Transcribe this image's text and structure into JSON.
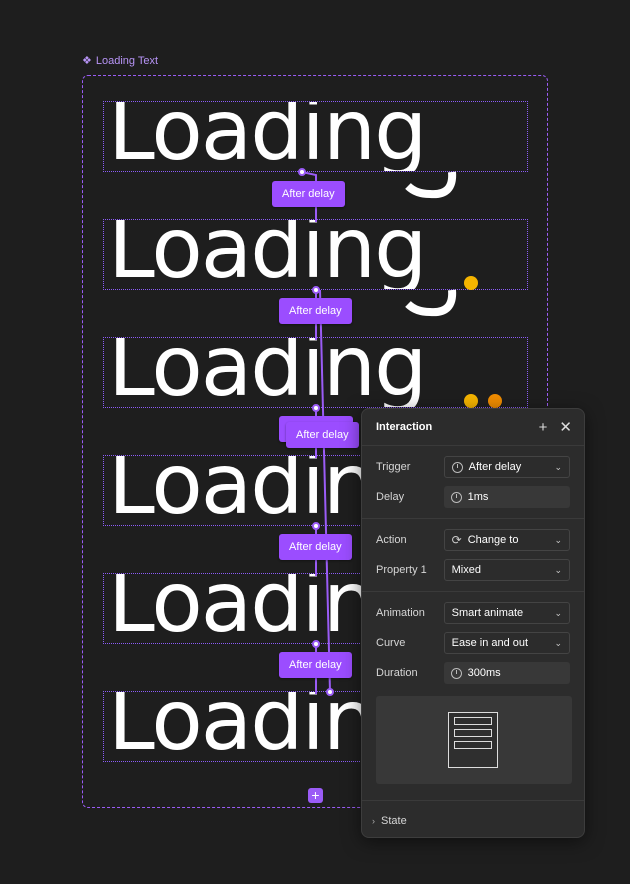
{
  "component": {
    "label": "Loading Text",
    "icon": "component-icon"
  },
  "variants": [
    {
      "word": "Loading",
      "dots": 0
    },
    {
      "word": "Loading",
      "dots": 1
    },
    {
      "word": "Loading",
      "dots": 2
    },
    {
      "word": "Loading",
      "dots": 3
    },
    {
      "word": "Loading",
      "dots": 3
    },
    {
      "word": "Loading",
      "dots": 3
    }
  ],
  "connections": [
    {
      "label": "After delay"
    },
    {
      "label": "After delay"
    },
    {
      "label": "After delay"
    },
    {
      "label": "After delay"
    },
    {
      "label": "After delay"
    }
  ],
  "colors": {
    "accent": "#9b5cf6",
    "tag": "#9b4dff",
    "dot_yellow": "#f5b400",
    "dot_orange": "#f08c00",
    "canvas": "#1e1e1e",
    "panel": "#2c2c2c"
  },
  "panel": {
    "title": "Interaction",
    "add_icon": "plus-icon",
    "close_icon": "close-icon",
    "trigger": {
      "label": "Trigger",
      "value": "After delay",
      "icon": "timer-icon"
    },
    "delay": {
      "label": "Delay",
      "value": "1ms",
      "icon": "timer-icon"
    },
    "action": {
      "label": "Action",
      "value": "Change to",
      "icon": "swap-icon"
    },
    "property": {
      "label": "Property 1",
      "value": "Mixed"
    },
    "animation": {
      "label": "Animation",
      "value": "Smart animate"
    },
    "curve": {
      "label": "Curve",
      "value": "Ease in and out"
    },
    "duration": {
      "label": "Duration",
      "value": "300ms",
      "icon": "timer-icon"
    },
    "state": {
      "label": "State"
    }
  }
}
